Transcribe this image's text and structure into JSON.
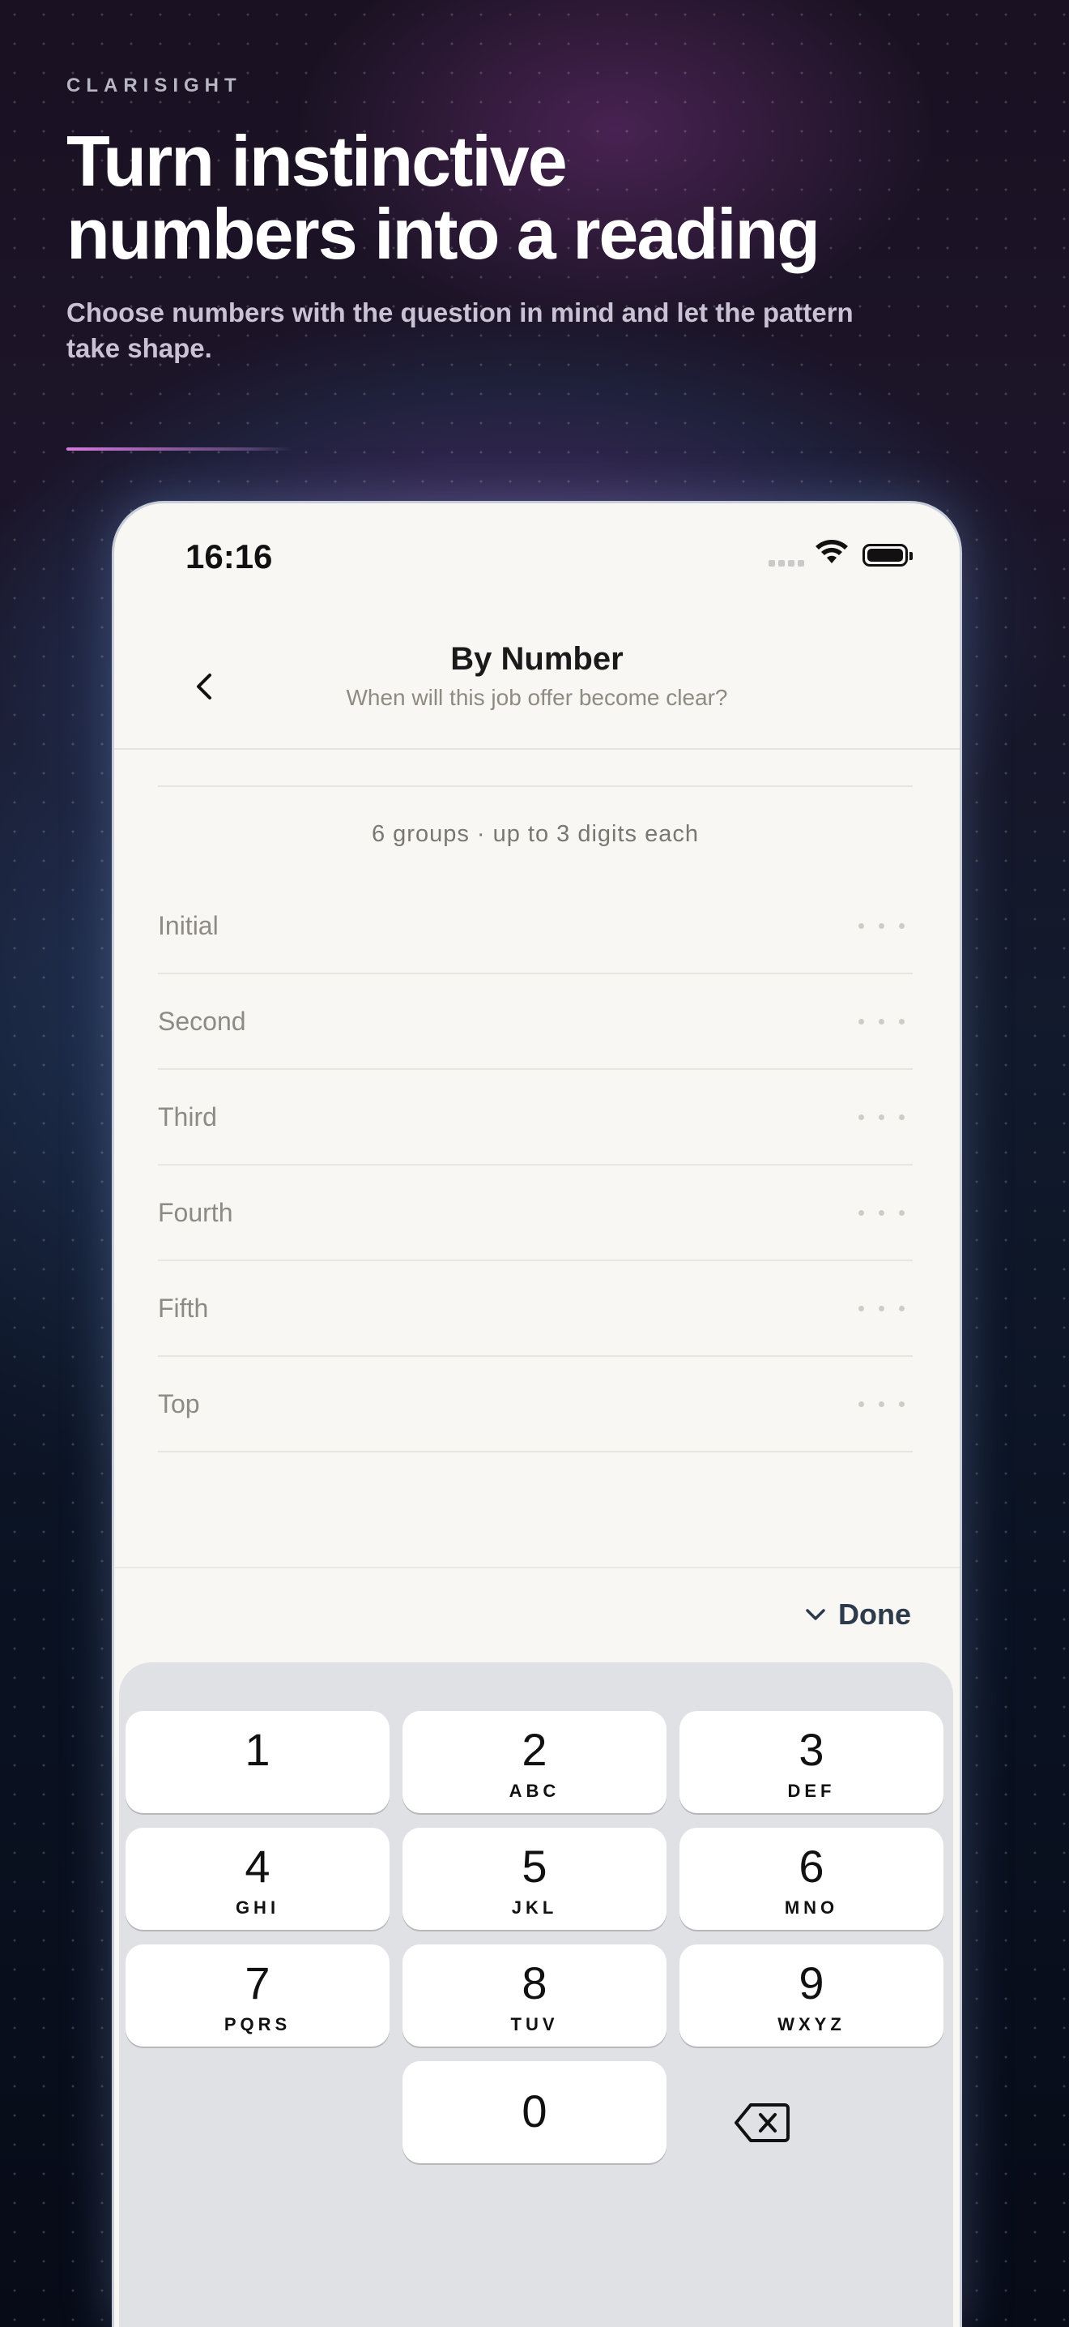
{
  "brand": "CLARISIGHT",
  "headline": {
    "line1": "Turn instinctive",
    "line2": "numbers into a reading"
  },
  "subheadline": "Choose numbers with the question in mind and let the pattern take shape.",
  "status_bar": {
    "time": "16:16"
  },
  "nav": {
    "title": "By Number",
    "subtitle": "When will this job offer become clear?"
  },
  "groups_note": "6 groups · up to 3 digits each",
  "rows": [
    {
      "label": "Initial"
    },
    {
      "label": "Second"
    },
    {
      "label": "Third"
    },
    {
      "label": "Fourth"
    },
    {
      "label": "Fifth"
    },
    {
      "label": "Top"
    }
  ],
  "accessory": {
    "done_label": "Done"
  },
  "keypad": [
    {
      "num": "1",
      "letters": ""
    },
    {
      "num": "2",
      "letters": "ABC"
    },
    {
      "num": "3",
      "letters": "DEF"
    },
    {
      "num": "4",
      "letters": "GHI"
    },
    {
      "num": "5",
      "letters": "JKL"
    },
    {
      "num": "6",
      "letters": "MNO"
    },
    {
      "num": "7",
      "letters": "PQRS"
    },
    {
      "num": "8",
      "letters": "TUV"
    },
    {
      "num": "9",
      "letters": "WXYZ"
    },
    {
      "num": "0",
      "letters": ""
    }
  ],
  "colors": {
    "accent": "#d57be0",
    "screen_bg": "#f8f7f4",
    "keyboard_bg": "#e0e1e4",
    "done_text": "#2c3a4c"
  },
  "icons": {
    "back": "chevron-left-icon",
    "done": "chevron-down-icon",
    "delete": "backspace-icon",
    "wifi": "wifi-icon",
    "battery": "battery-icon"
  }
}
